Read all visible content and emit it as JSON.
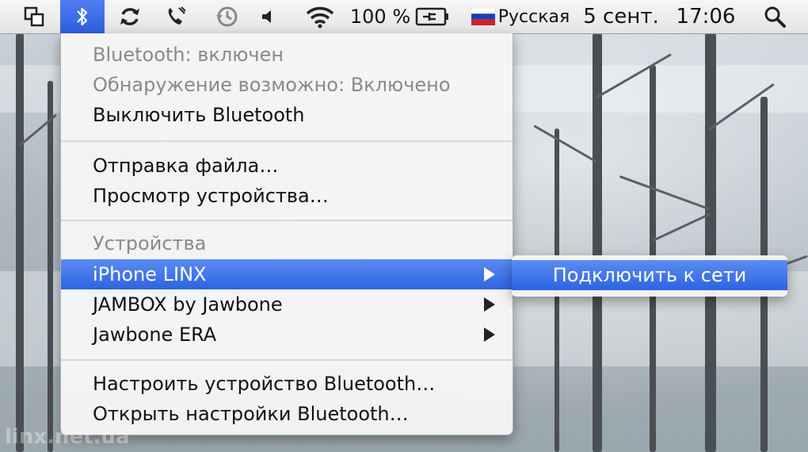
{
  "menubar": {
    "icons": [
      {
        "name": "window-switcher-icon"
      },
      {
        "name": "bluetooth-icon"
      },
      {
        "name": "sync-icon"
      },
      {
        "name": "phone-icon"
      },
      {
        "name": "time-machine-icon"
      },
      {
        "name": "volume-icon"
      },
      {
        "name": "wifi-icon"
      }
    ],
    "battery_percent": "100 %",
    "input_language": "Русская",
    "date": "5 сент.",
    "time": "17:06",
    "accent_color": "#2e63e2"
  },
  "menu": {
    "status_items": [
      "Bluetooth: включен",
      "Обнаружение возможно: Включено"
    ],
    "toggle_label": "Выключить Bluetooth",
    "file_actions": [
      "Отправка файла…",
      "Просмотр устройства…"
    ],
    "devices_header": "Устройства",
    "devices": [
      "iPhone LINX",
      "JAMBOX by Jawbone",
      "Jawbone ERA"
    ],
    "settings_items": [
      "Настроить устройство Bluetooth…",
      "Открыть настройки Bluetooth…"
    ]
  },
  "submenu": {
    "connect_label": "Подключить к сети"
  },
  "watermark": "linx.net.ua"
}
